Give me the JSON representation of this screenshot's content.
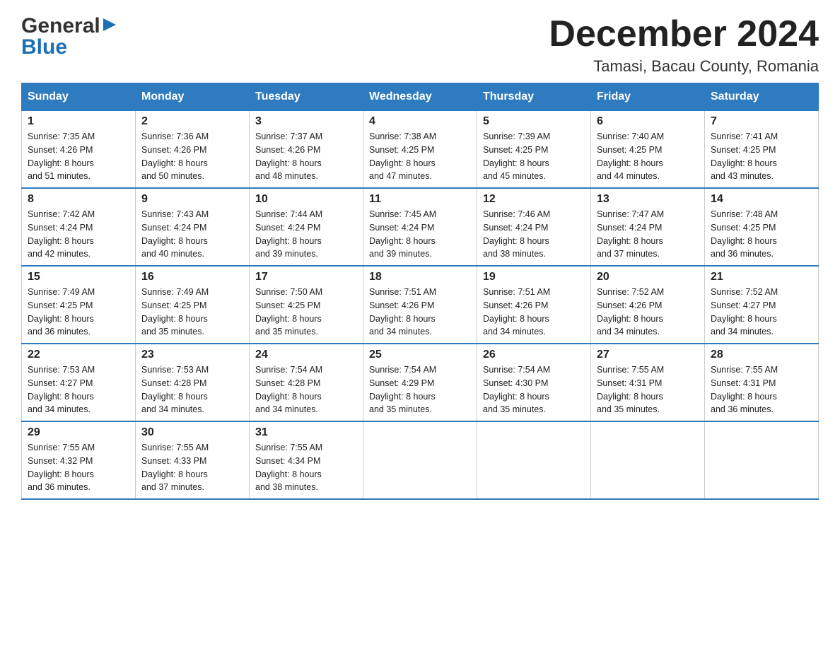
{
  "logo": {
    "general": "General",
    "blue": "Blue"
  },
  "title": "December 2024",
  "location": "Tamasi, Bacau County, Romania",
  "days_of_week": [
    "Sunday",
    "Monday",
    "Tuesday",
    "Wednesday",
    "Thursday",
    "Friday",
    "Saturday"
  ],
  "weeks": [
    [
      {
        "day": "1",
        "sunrise": "7:35 AM",
        "sunset": "4:26 PM",
        "daylight": "8 hours and 51 minutes."
      },
      {
        "day": "2",
        "sunrise": "7:36 AM",
        "sunset": "4:26 PM",
        "daylight": "8 hours and 50 minutes."
      },
      {
        "day": "3",
        "sunrise": "7:37 AM",
        "sunset": "4:26 PM",
        "daylight": "8 hours and 48 minutes."
      },
      {
        "day": "4",
        "sunrise": "7:38 AM",
        "sunset": "4:25 PM",
        "daylight": "8 hours and 47 minutes."
      },
      {
        "day": "5",
        "sunrise": "7:39 AM",
        "sunset": "4:25 PM",
        "daylight": "8 hours and 45 minutes."
      },
      {
        "day": "6",
        "sunrise": "7:40 AM",
        "sunset": "4:25 PM",
        "daylight": "8 hours and 44 minutes."
      },
      {
        "day": "7",
        "sunrise": "7:41 AM",
        "sunset": "4:25 PM",
        "daylight": "8 hours and 43 minutes."
      }
    ],
    [
      {
        "day": "8",
        "sunrise": "7:42 AM",
        "sunset": "4:24 PM",
        "daylight": "8 hours and 42 minutes."
      },
      {
        "day": "9",
        "sunrise": "7:43 AM",
        "sunset": "4:24 PM",
        "daylight": "8 hours and 40 minutes."
      },
      {
        "day": "10",
        "sunrise": "7:44 AM",
        "sunset": "4:24 PM",
        "daylight": "8 hours and 39 minutes."
      },
      {
        "day": "11",
        "sunrise": "7:45 AM",
        "sunset": "4:24 PM",
        "daylight": "8 hours and 39 minutes."
      },
      {
        "day": "12",
        "sunrise": "7:46 AM",
        "sunset": "4:24 PM",
        "daylight": "8 hours and 38 minutes."
      },
      {
        "day": "13",
        "sunrise": "7:47 AM",
        "sunset": "4:24 PM",
        "daylight": "8 hours and 37 minutes."
      },
      {
        "day": "14",
        "sunrise": "7:48 AM",
        "sunset": "4:25 PM",
        "daylight": "8 hours and 36 minutes."
      }
    ],
    [
      {
        "day": "15",
        "sunrise": "7:49 AM",
        "sunset": "4:25 PM",
        "daylight": "8 hours and 36 minutes."
      },
      {
        "day": "16",
        "sunrise": "7:49 AM",
        "sunset": "4:25 PM",
        "daylight": "8 hours and 35 minutes."
      },
      {
        "day": "17",
        "sunrise": "7:50 AM",
        "sunset": "4:25 PM",
        "daylight": "8 hours and 35 minutes."
      },
      {
        "day": "18",
        "sunrise": "7:51 AM",
        "sunset": "4:26 PM",
        "daylight": "8 hours and 34 minutes."
      },
      {
        "day": "19",
        "sunrise": "7:51 AM",
        "sunset": "4:26 PM",
        "daylight": "8 hours and 34 minutes."
      },
      {
        "day": "20",
        "sunrise": "7:52 AM",
        "sunset": "4:26 PM",
        "daylight": "8 hours and 34 minutes."
      },
      {
        "day": "21",
        "sunrise": "7:52 AM",
        "sunset": "4:27 PM",
        "daylight": "8 hours and 34 minutes."
      }
    ],
    [
      {
        "day": "22",
        "sunrise": "7:53 AM",
        "sunset": "4:27 PM",
        "daylight": "8 hours and 34 minutes."
      },
      {
        "day": "23",
        "sunrise": "7:53 AM",
        "sunset": "4:28 PM",
        "daylight": "8 hours and 34 minutes."
      },
      {
        "day": "24",
        "sunrise": "7:54 AM",
        "sunset": "4:28 PM",
        "daylight": "8 hours and 34 minutes."
      },
      {
        "day": "25",
        "sunrise": "7:54 AM",
        "sunset": "4:29 PM",
        "daylight": "8 hours and 35 minutes."
      },
      {
        "day": "26",
        "sunrise": "7:54 AM",
        "sunset": "4:30 PM",
        "daylight": "8 hours and 35 minutes."
      },
      {
        "day": "27",
        "sunrise": "7:55 AM",
        "sunset": "4:31 PM",
        "daylight": "8 hours and 35 minutes."
      },
      {
        "day": "28",
        "sunrise": "7:55 AM",
        "sunset": "4:31 PM",
        "daylight": "8 hours and 36 minutes."
      }
    ],
    [
      {
        "day": "29",
        "sunrise": "7:55 AM",
        "sunset": "4:32 PM",
        "daylight": "8 hours and 36 minutes."
      },
      {
        "day": "30",
        "sunrise": "7:55 AM",
        "sunset": "4:33 PM",
        "daylight": "8 hours and 37 minutes."
      },
      {
        "day": "31",
        "sunrise": "7:55 AM",
        "sunset": "4:34 PM",
        "daylight": "8 hours and 38 minutes."
      },
      null,
      null,
      null,
      null
    ]
  ],
  "labels": {
    "sunrise": "Sunrise:",
    "sunset": "Sunset:",
    "daylight": "Daylight:"
  }
}
